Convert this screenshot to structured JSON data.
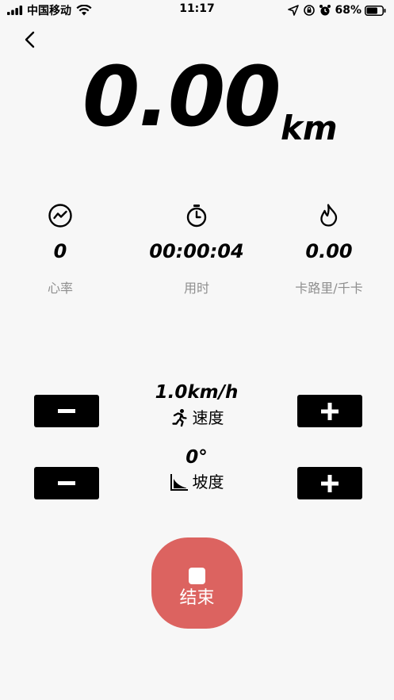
{
  "status_bar": {
    "carrier": "中国移动",
    "time": "11:17",
    "battery_percent": "68%"
  },
  "distance": {
    "value": "0.00",
    "unit": "km"
  },
  "stats": [
    {
      "icon": "heart-rate-icon",
      "value": "0",
      "label": "心率"
    },
    {
      "icon": "stopwatch-icon",
      "value": "00:00:04",
      "label": "用时"
    },
    {
      "icon": "flame-icon",
      "value": "0.00",
      "label": "卡路里/千卡"
    }
  ],
  "speed": {
    "value": "1.0km/h",
    "label": "速度",
    "icon": "running-person-icon"
  },
  "incline": {
    "value": "0°",
    "label": "坡度",
    "icon": "incline-icon"
  },
  "end_button": {
    "label": "结束"
  },
  "colors": {
    "background": "#f7f7f7",
    "end_button": "#dc6360",
    "secondary_text": "#8f8f8f"
  }
}
